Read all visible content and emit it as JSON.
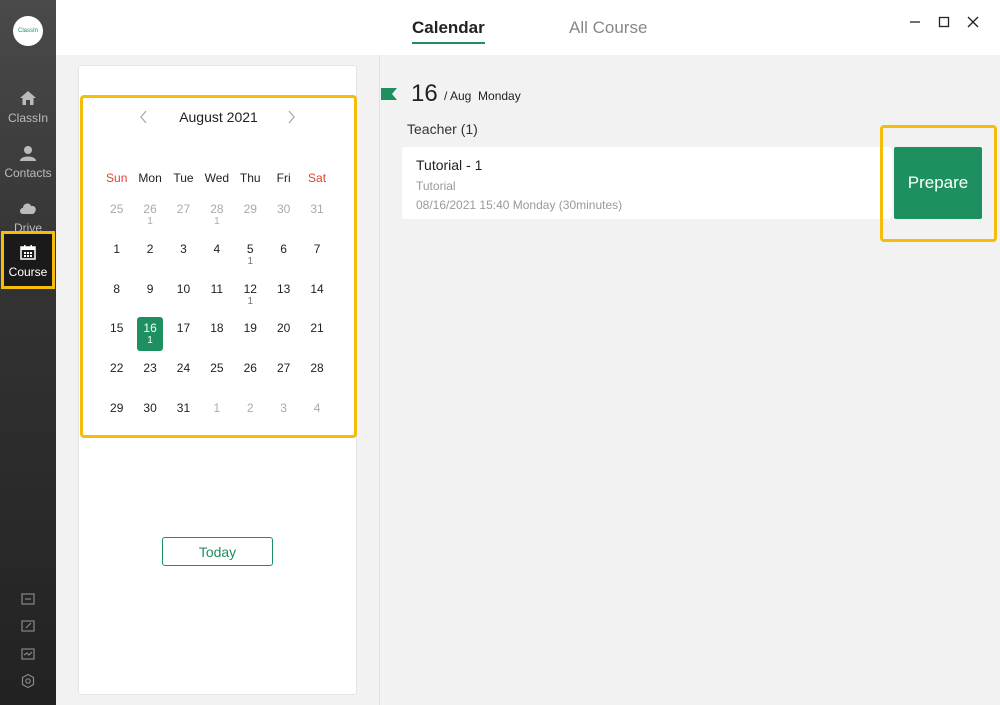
{
  "app": {
    "logo_text": "ClassIn"
  },
  "sidebar": {
    "items": [
      {
        "label": "ClassIn",
        "icon": "home-icon"
      },
      {
        "label": "Contacts",
        "icon": "contacts-icon"
      },
      {
        "label": "Drive",
        "icon": "cloud-icon"
      },
      {
        "label": "Course",
        "icon": "calendar-icon",
        "active": true
      }
    ],
    "bottom_icons": [
      "folder-icon",
      "edit-icon",
      "monitor-icon",
      "settings-icon"
    ]
  },
  "header": {
    "tabs": [
      {
        "label": "Calendar",
        "active": true
      },
      {
        "label": "All Course",
        "active": false
      }
    ]
  },
  "calendar": {
    "month_label": "August 2021",
    "weekdays": [
      "Sun",
      "Mon",
      "Tue",
      "Wed",
      "Thu",
      "Fri",
      "Sat"
    ],
    "days": [
      {
        "d": "25",
        "c": "",
        "muted": true
      },
      {
        "d": "26",
        "c": "1",
        "muted": true
      },
      {
        "d": "27",
        "c": "",
        "muted": true
      },
      {
        "d": "28",
        "c": "1",
        "muted": true
      },
      {
        "d": "29",
        "c": "",
        "muted": true
      },
      {
        "d": "30",
        "c": "",
        "muted": true
      },
      {
        "d": "31",
        "c": "",
        "muted": true
      },
      {
        "d": "1",
        "c": ""
      },
      {
        "d": "2",
        "c": ""
      },
      {
        "d": "3",
        "c": ""
      },
      {
        "d": "4",
        "c": ""
      },
      {
        "d": "5",
        "c": "1"
      },
      {
        "d": "6",
        "c": ""
      },
      {
        "d": "7",
        "c": ""
      },
      {
        "d": "8",
        "c": ""
      },
      {
        "d": "9",
        "c": ""
      },
      {
        "d": "10",
        "c": ""
      },
      {
        "d": "11",
        "c": ""
      },
      {
        "d": "12",
        "c": "1"
      },
      {
        "d": "13",
        "c": ""
      },
      {
        "d": "14",
        "c": ""
      },
      {
        "d": "15",
        "c": ""
      },
      {
        "d": "16",
        "c": "1",
        "selected": true
      },
      {
        "d": "17",
        "c": ""
      },
      {
        "d": "18",
        "c": ""
      },
      {
        "d": "19",
        "c": ""
      },
      {
        "d": "20",
        "c": ""
      },
      {
        "d": "21",
        "c": ""
      },
      {
        "d": "22",
        "c": ""
      },
      {
        "d": "23",
        "c": ""
      },
      {
        "d": "24",
        "c": ""
      },
      {
        "d": "25",
        "c": ""
      },
      {
        "d": "26",
        "c": ""
      },
      {
        "d": "27",
        "c": ""
      },
      {
        "d": "28",
        "c": ""
      },
      {
        "d": "29",
        "c": ""
      },
      {
        "d": "30",
        "c": ""
      },
      {
        "d": "31",
        "c": ""
      },
      {
        "d": "1",
        "c": "",
        "muted": true
      },
      {
        "d": "2",
        "c": "",
        "muted": true
      },
      {
        "d": "3",
        "c": "",
        "muted": true
      },
      {
        "d": "4",
        "c": "",
        "muted": true
      }
    ],
    "today_label": "Today"
  },
  "detail": {
    "day_number": "16",
    "day_sub": "/ Aug  Monday",
    "teacher_label": "Teacher (1)",
    "course": {
      "title": "Tutorial - 1",
      "type": "Tutorial",
      "time": "08/16/2021 15:40 Monday (30minutes)"
    },
    "prepare_label": "Prepare"
  },
  "colors": {
    "accent": "#1e8f5e",
    "highlight": "#f5bc0a",
    "weekend": "#e0442e"
  }
}
